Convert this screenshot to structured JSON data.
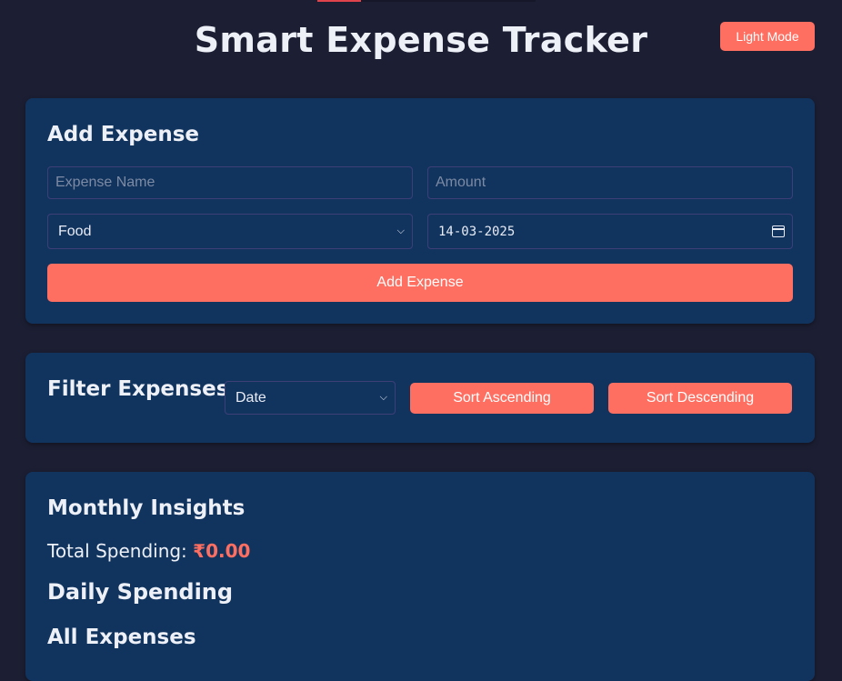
{
  "header": {
    "title": "Smart Expense Tracker",
    "theme_toggle_label": "Light Mode"
  },
  "add_expense": {
    "heading": "Add Expense",
    "name_placeholder": "Expense Name",
    "amount_placeholder": "Amount",
    "category_selected": "Food",
    "date_value": "14-03-2025",
    "submit_label": "Add Expense"
  },
  "filter": {
    "heading": "Filter Expenses",
    "sort_by_selected": "Date",
    "sort_ascending_label": "Sort Ascending",
    "sort_descending_label": "Sort Descending"
  },
  "insights": {
    "heading": "Monthly Insights",
    "total_label": "Total Spending:",
    "total_value": "₹0.00",
    "daily_heading": "Daily Spending",
    "all_heading": "All Expenses"
  },
  "colors": {
    "background": "#1c1e33",
    "card": "#11345f",
    "accent": "#ff6f61",
    "border": "#3f3f78"
  },
  "icons": [
    "chevron-down-icon",
    "calendar-icon"
  ]
}
